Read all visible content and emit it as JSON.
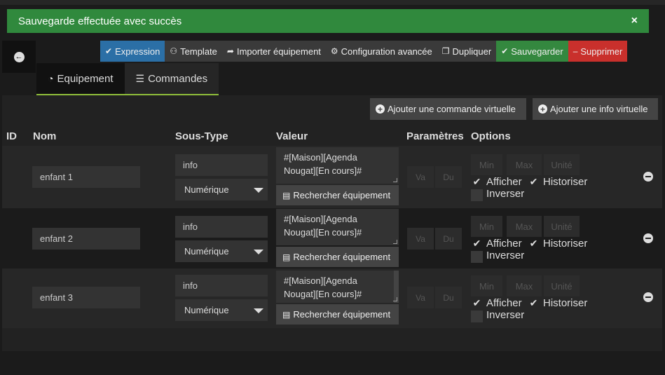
{
  "alert": {
    "message": "Sauvegarde effectuée avec succès",
    "close": "×"
  },
  "toolbar": {
    "buttons": [
      {
        "icon": "✔",
        "label": "Expression"
      },
      {
        "icon": "⚇",
        "label": "Template"
      },
      {
        "icon": "➦",
        "label": "Importer équipement"
      },
      {
        "icon": "⚙",
        "label": "Configuration avancée"
      },
      {
        "icon": "❐",
        "label": "Dupliquer"
      },
      {
        "icon": "✔",
        "label": "Sauvegarder"
      },
      {
        "icon": "–",
        "label": "Supprimer"
      }
    ]
  },
  "back": {
    "icon": "←"
  },
  "tabs": [
    {
      "icon": "◔",
      "label": "Equipement"
    },
    {
      "icon": "☰",
      "label": "Commandes"
    }
  ],
  "actions": {
    "add_command": "Ajouter une commande virtuelle",
    "add_info": "Ajouter une info virtuelle",
    "plus": "+"
  },
  "table": {
    "headers": {
      "id": "ID",
      "nom": "Nom",
      "sous_type": "Sous-Type",
      "valeur": "Valeur",
      "parametres": "Paramètres",
      "options": "Options"
    },
    "rows": [
      {
        "nom": "enfant 1",
        "type": "info",
        "subtype": "Numérique",
        "value_line1": "#[Maison][Agenda",
        "value_line2": "Nougat][En cours]#",
        "search": "Rechercher équipement",
        "search_icon": "▤",
        "param_va": "Va",
        "param_du": "Du",
        "min": "Min",
        "max": "Max",
        "unit": "Unité",
        "afficher": "Afficher",
        "historiser": "Historiser",
        "inverser": "Inverser",
        "check": "✔"
      },
      {
        "nom": "enfant 2",
        "type": "info",
        "subtype": "Numérique",
        "value_line1": "#[Maison][Agenda",
        "value_line2": "Nougat][En cours]#",
        "search": "Rechercher équipement",
        "search_icon": "▤",
        "param_va": "Va",
        "param_du": "Du",
        "min": "Min",
        "max": "Max",
        "unit": "Unité",
        "afficher": "Afficher",
        "historiser": "Historiser",
        "inverser": "Inverser",
        "check": "✔"
      },
      {
        "nom": "enfant 3",
        "type": "info",
        "subtype": "Numérique",
        "value_line1": "#[Maison][Agenda",
        "value_line2": "Nougat][En cours]#",
        "search": "Rechercher équipement",
        "search_icon": "▤",
        "param_va": "Va",
        "param_du": "Du",
        "min": "Min",
        "max": "Max",
        "unit": "Unité",
        "afficher": "Afficher",
        "historiser": "Historiser",
        "inverser": "Inverser",
        "check": "✔"
      }
    ]
  },
  "colors": {
    "success": "#30893d",
    "primary": "#2b6fa6",
    "save": "#34883f",
    "danger": "#c9302c",
    "tab_accent": "#8fbe3a"
  }
}
